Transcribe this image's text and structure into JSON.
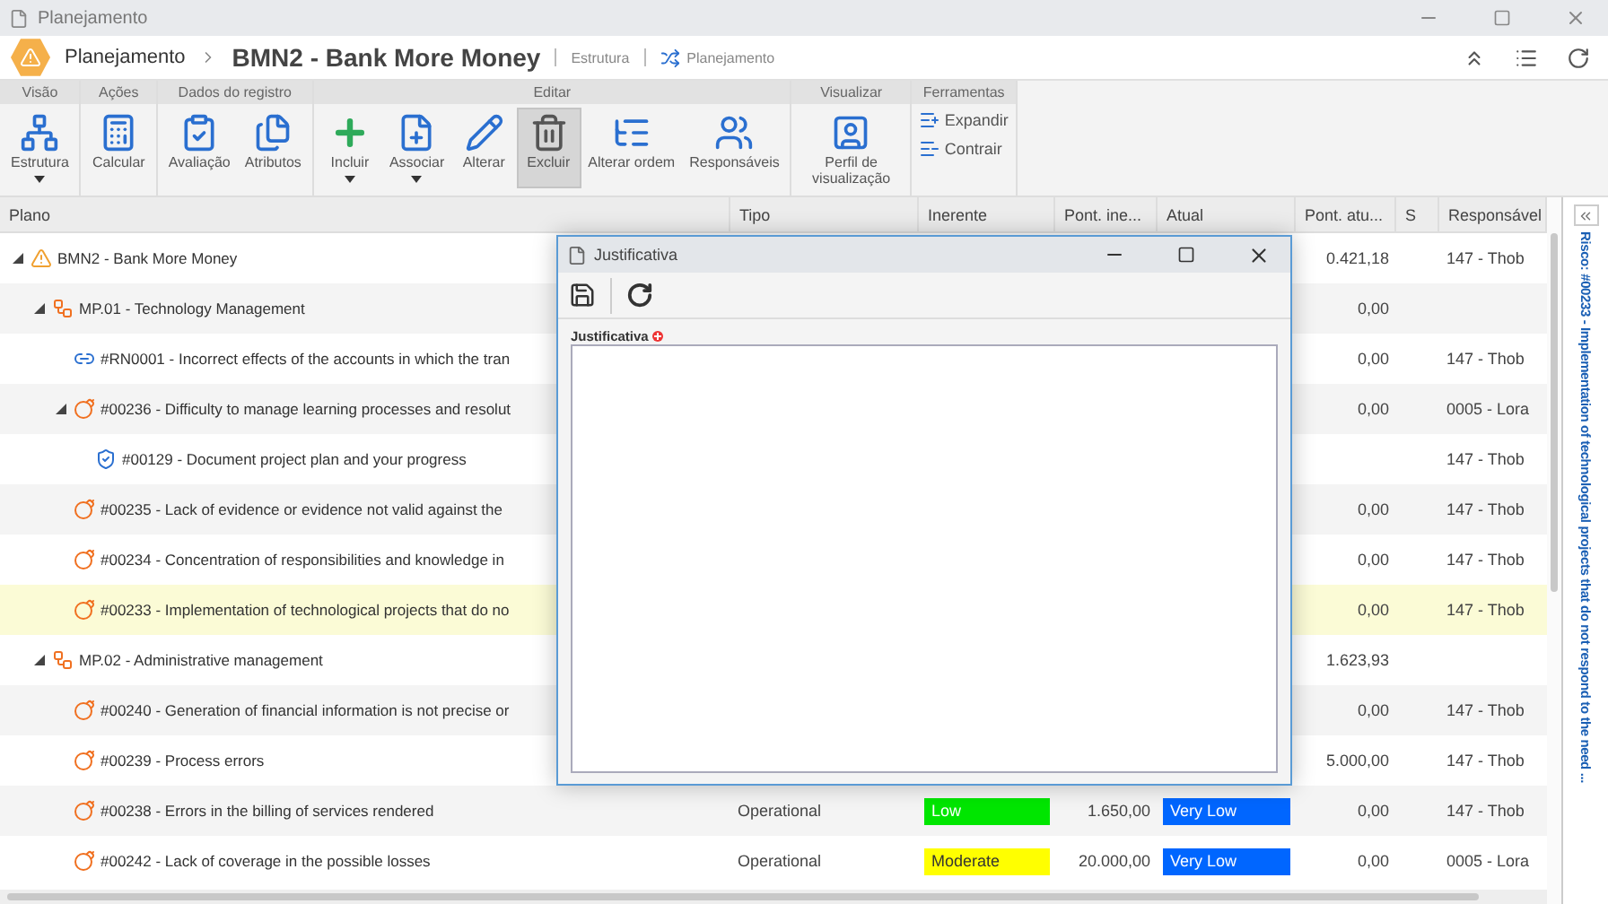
{
  "window": {
    "title": "Planejamento"
  },
  "header": {
    "breadcrumb": "Planejamento",
    "title": "BMN2 - Bank More Money",
    "tabs": [
      {
        "label": "Estrutura",
        "kind": "plain"
      },
      {
        "label": "Planejamento",
        "kind": "icon"
      }
    ]
  },
  "ribbon": {
    "groups": [
      {
        "label": "Visão",
        "buttons": [
          {
            "label": "Estrutura",
            "has_menu": true,
            "selected": false
          }
        ]
      },
      {
        "label": "Ações",
        "buttons": [
          {
            "label": "Calcular",
            "has_menu": false,
            "selected": false
          }
        ]
      },
      {
        "label": "Dados do registro",
        "buttons": [
          {
            "label": "Avaliação",
            "has_menu": false,
            "selected": false
          },
          {
            "label": "Atributos",
            "has_menu": false,
            "selected": false
          }
        ]
      },
      {
        "label": "Editar",
        "buttons": [
          {
            "label": "Incluir",
            "has_menu": true,
            "selected": false
          },
          {
            "label": "Associar",
            "has_menu": true,
            "selected": false
          },
          {
            "label": "Alterar",
            "has_menu": false,
            "selected": false
          },
          {
            "label": "Excluir",
            "has_menu": false,
            "selected": true
          },
          {
            "label": "Alterar ordem",
            "has_menu": false,
            "selected": false
          },
          {
            "label": "Responsáveis",
            "has_menu": false,
            "selected": false
          }
        ]
      },
      {
        "label": "Visualizar",
        "buttons": [
          {
            "label": "Perfil de visualização",
            "has_menu": false,
            "selected": false
          }
        ]
      },
      {
        "label": "Ferramentas",
        "kind": "small",
        "buttons": [
          {
            "label": "Expandir"
          },
          {
            "label": "Contrair"
          }
        ]
      }
    ]
  },
  "table": {
    "columns": [
      "Plano",
      "Tipo",
      "Inerente",
      "Pont. ine...",
      "Atual",
      "Pont. atu...",
      "S",
      "Responsável"
    ],
    "rows": [
      {
        "kind": "plan",
        "label": "BMN2 - Bank More Money",
        "expanded": true,
        "selected": false,
        "pont_atual": "0.421,18",
        "responsavel": "147 - Thob",
        "children": [
          {
            "kind": "process",
            "label": "MP.01 - Technology Management",
            "expanded": true,
            "selected": false,
            "pont_atual": "0,00",
            "children": [
              {
                "kind": "requirement",
                "label": "#RN0001 - Incorrect effects of the accounts in which the tran",
                "selected": false,
                "pont_atual": "0,00",
                "responsavel": "147 - Thob"
              },
              {
                "kind": "risk",
                "label": "#00236 - Difficulty to manage learning processes and resolut",
                "expanded": true,
                "selected": false,
                "pont_atual": "0,00",
                "responsavel": "0005 - Lora",
                "children": [
                  {
                    "kind": "control",
                    "label": "#00129 - Document project plan and your progress",
                    "selected": false,
                    "responsavel": "147 - Thob"
                  }
                ]
              },
              {
                "kind": "risk",
                "label": "#00235 - Lack of evidence or evidence not valid against the",
                "selected": false,
                "pont_atual": "0,00",
                "responsavel": "147 - Thob"
              },
              {
                "kind": "risk",
                "label": "#00234 - Concentration of responsibilities and knowledge in",
                "selected": false,
                "pont_atual": "0,00",
                "responsavel": "147 - Thob"
              },
              {
                "kind": "risk",
                "label": "#00233 - Implementation of technological projects that do no",
                "selected": true,
                "pont_atual": "0,00",
                "responsavel": "147 - Thob"
              }
            ]
          },
          {
            "kind": "process",
            "label": "MP.02 - Administrative management",
            "expanded": true,
            "selected": false,
            "pont_atual": "1.623,93",
            "children": [
              {
                "kind": "risk",
                "label": "#00240 - Generation of financial information is not precise or",
                "selected": false,
                "pont_atual": "0,00",
                "responsavel": "147 - Thob"
              },
              {
                "kind": "risk",
                "label": "#00239 - Process errors",
                "selected": false,
                "pont_atual": "5.000,00",
                "responsavel": "147 - Thob"
              },
              {
                "kind": "risk",
                "label": "#00238 - Errors in the billing of services rendered",
                "selected": false,
                "tipo": "Operational",
                "inerente": {
                  "label": "Low",
                  "color": "#00e600"
                },
                "pont_inerente": "1.650,00",
                "atual": {
                  "label": "Very Low",
                  "color": "#0066ff"
                },
                "pont_atual": "0,00",
                "responsavel": "147 - Thob"
              },
              {
                "kind": "risk",
                "label": "#00242 - Lack of coverage in the possible losses",
                "selected": false,
                "tipo": "Operational",
                "inerente": {
                  "label": "Moderate",
                  "color": "#ffff00"
                },
                "pont_inerente": "20.000,00",
                "atual": {
                  "label": "Very Low",
                  "color": "#0066ff"
                },
                "pont_atual": "0,00",
                "responsavel": "0005 - Lora"
              }
            ]
          }
        ]
      }
    ]
  },
  "side_panel": {
    "title": "Risco: #00233 - Implementation of technological projects that do not respond to the need ..."
  },
  "dialog": {
    "title": "Justificativa",
    "field": {
      "label": "Justificativa",
      "required": true
    }
  }
}
